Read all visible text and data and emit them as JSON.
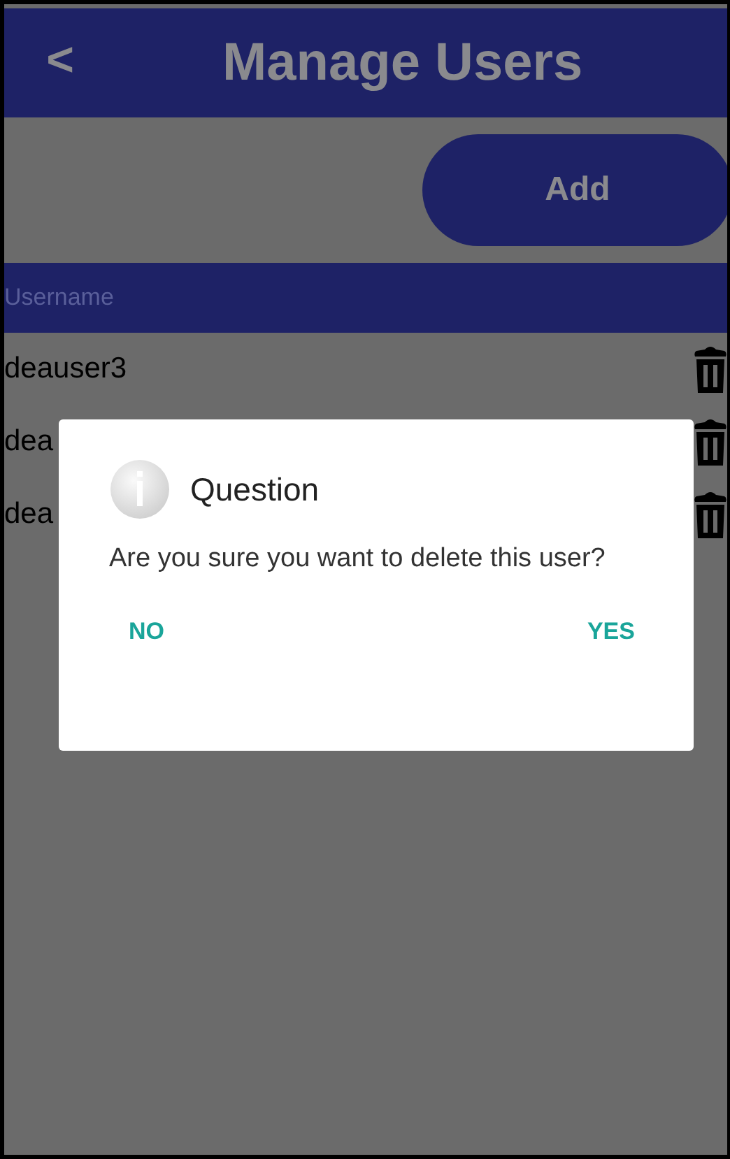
{
  "header": {
    "back": "<",
    "title": "Manage Users"
  },
  "add_button": "Add",
  "table": {
    "columns": [
      "Username"
    ],
    "rows": [
      {
        "username": "deauser3"
      },
      {
        "username": "dea"
      },
      {
        "username": "dea"
      }
    ]
  },
  "dialog": {
    "title": "Question",
    "message": "Are you sure you want to delete this user?",
    "buttons": [
      "NO",
      "YES"
    ]
  }
}
